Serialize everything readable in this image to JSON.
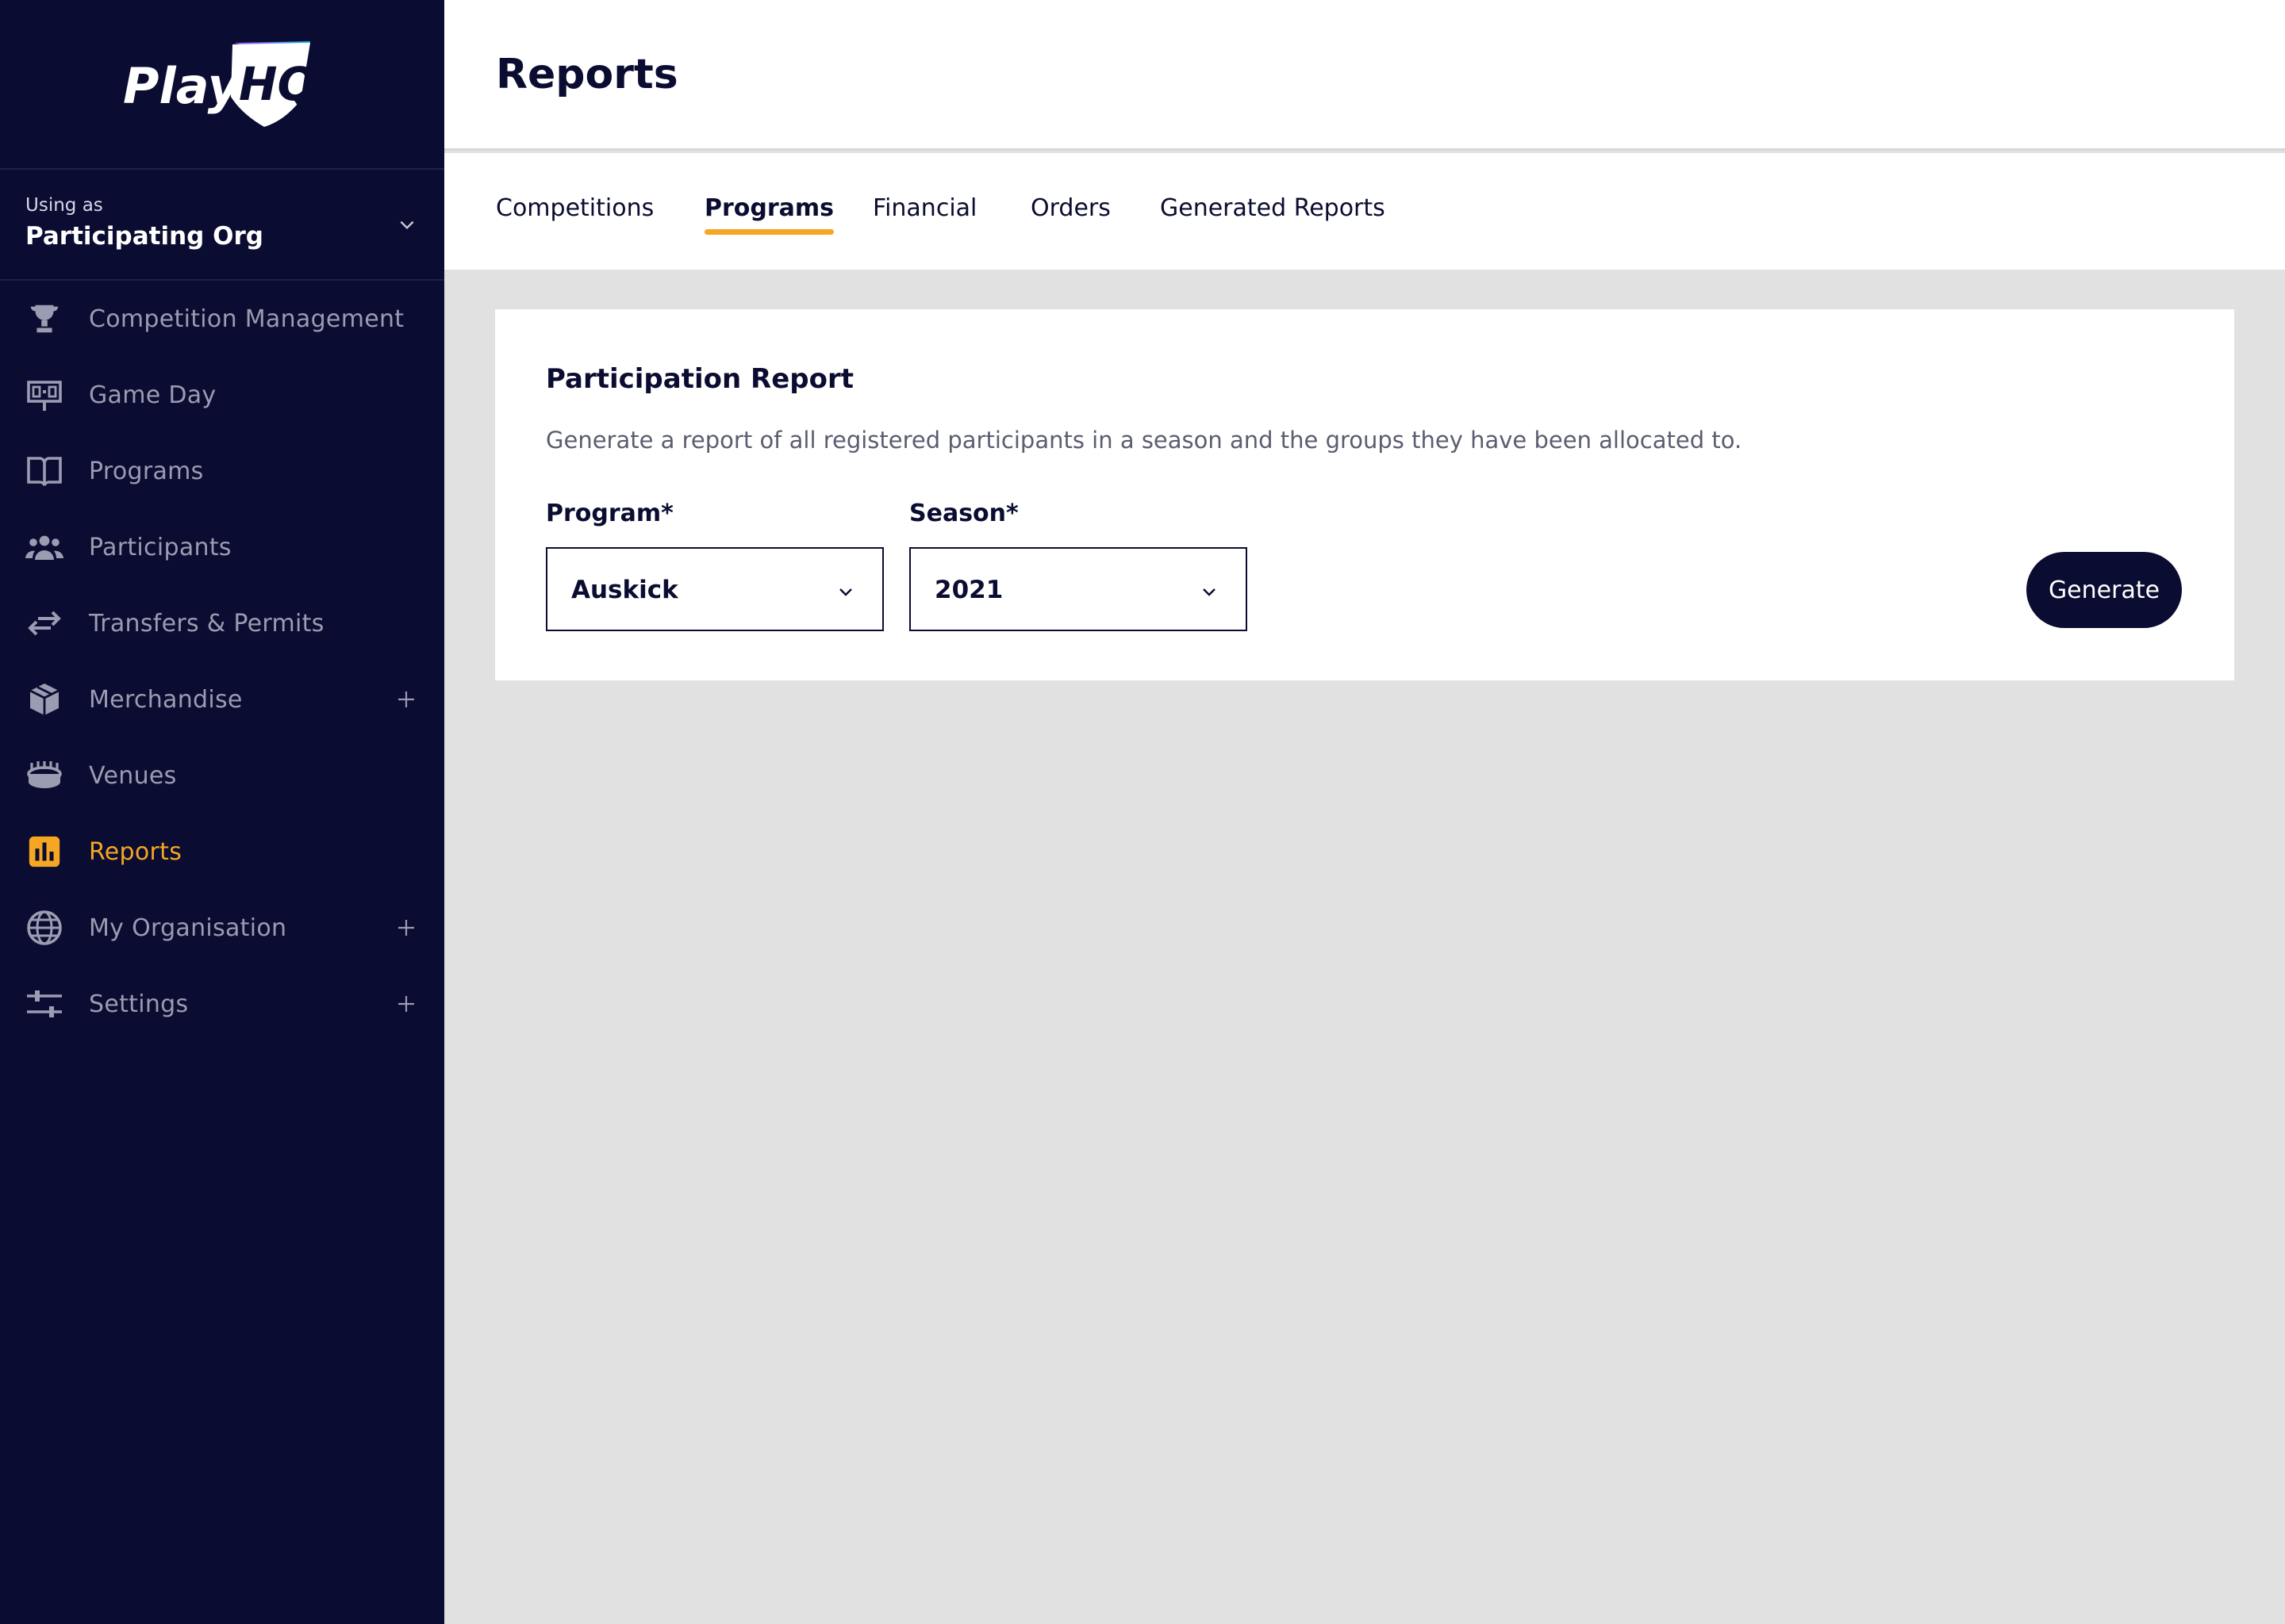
{
  "brand": {
    "logo_text_play": "Play",
    "logo_text_hq": "HQ"
  },
  "org_switcher": {
    "caption": "Using as",
    "name": "Participating Org"
  },
  "sidebar": {
    "items": [
      {
        "label": "Competition Management",
        "icon": "trophy-icon"
      },
      {
        "label": "Game Day",
        "icon": "scoreboard-icon"
      },
      {
        "label": "Programs",
        "icon": "book-icon"
      },
      {
        "label": "Participants",
        "icon": "people-icon"
      },
      {
        "label": "Transfers & Permits",
        "icon": "transfer-arrows-icon"
      },
      {
        "label": "Merchandise",
        "icon": "box-icon",
        "expandable": true
      },
      {
        "label": "Venues",
        "icon": "stadium-icon"
      },
      {
        "label": "Reports",
        "icon": "bar-chart-icon",
        "active": true
      },
      {
        "label": "My Organisation",
        "icon": "globe-icon",
        "expandable": true
      },
      {
        "label": "Settings",
        "icon": "sliders-icon",
        "expandable": true
      }
    ],
    "active_color": "#f5a623"
  },
  "header": {
    "title": "Reports"
  },
  "tabs": [
    {
      "label": "Competitions"
    },
    {
      "label": "Programs",
      "active": true
    },
    {
      "label": "Financial"
    },
    {
      "label": "Orders"
    },
    {
      "label": "Generated Reports"
    }
  ],
  "report_card": {
    "title": "Participation Report",
    "description": "Generate a report of all registered participants in a season and the groups they have been allocated to.",
    "program_label": "Program*",
    "program_value": "Auskick",
    "season_label": "Season*",
    "season_value": "2021",
    "generate_label": "Generate"
  },
  "colors": {
    "navy": "#0b0c31",
    "accent": "#f5a623",
    "background": "#e1e1e1"
  }
}
